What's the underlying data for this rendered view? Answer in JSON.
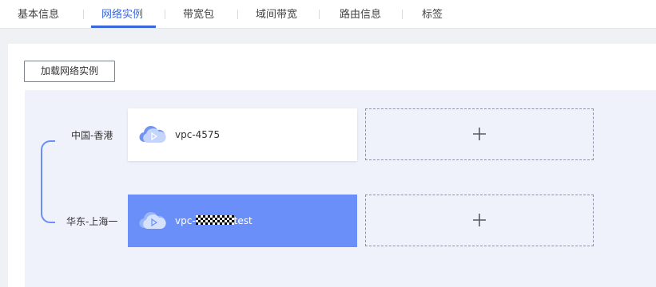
{
  "tabs": [
    {
      "label": "基本信息",
      "active": false
    },
    {
      "label": "网络实例",
      "active": true
    },
    {
      "label": "带宽包",
      "active": false
    },
    {
      "label": "域间带宽",
      "active": false
    },
    {
      "label": "路由信息",
      "active": false
    },
    {
      "label": "标签",
      "active": false
    }
  ],
  "toolbar": {
    "load_button_label": "加载网络实例"
  },
  "regions": [
    {
      "name": "中国-香港",
      "instances": [
        {
          "label": "vpc-4575",
          "selected": false
        }
      ]
    },
    {
      "name": "华东-上海一",
      "instances": [
        {
          "label_prefix": "vpc-",
          "label_suffix": "test",
          "masked": true,
          "selected": true
        }
      ]
    }
  ],
  "add_slots": [
    {
      "icon": "plus-icon"
    },
    {
      "icon": "plus-icon"
    }
  ],
  "colors": {
    "accent": "#3a66db",
    "selected_card": "#6a8ff8",
    "bracket": "#6c8ef5",
    "canvas": "#eff2fa"
  }
}
